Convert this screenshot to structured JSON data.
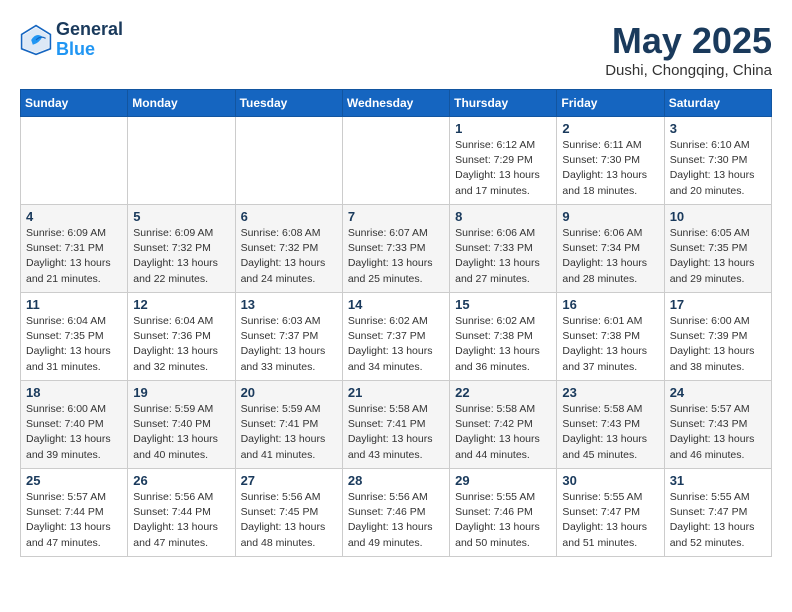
{
  "header": {
    "logo_line1": "General",
    "logo_line2": "Blue",
    "month": "May 2025",
    "location": "Dushi, Chongqing, China"
  },
  "days_of_week": [
    "Sunday",
    "Monday",
    "Tuesday",
    "Wednesday",
    "Thursday",
    "Friday",
    "Saturday"
  ],
  "weeks": [
    [
      {
        "day": "",
        "info": ""
      },
      {
        "day": "",
        "info": ""
      },
      {
        "day": "",
        "info": ""
      },
      {
        "day": "",
        "info": ""
      },
      {
        "day": "1",
        "info": "Sunrise: 6:12 AM\nSunset: 7:29 PM\nDaylight: 13 hours\nand 17 minutes."
      },
      {
        "day": "2",
        "info": "Sunrise: 6:11 AM\nSunset: 7:30 PM\nDaylight: 13 hours\nand 18 minutes."
      },
      {
        "day": "3",
        "info": "Sunrise: 6:10 AM\nSunset: 7:30 PM\nDaylight: 13 hours\nand 20 minutes."
      }
    ],
    [
      {
        "day": "4",
        "info": "Sunrise: 6:09 AM\nSunset: 7:31 PM\nDaylight: 13 hours\nand 21 minutes."
      },
      {
        "day": "5",
        "info": "Sunrise: 6:09 AM\nSunset: 7:32 PM\nDaylight: 13 hours\nand 22 minutes."
      },
      {
        "day": "6",
        "info": "Sunrise: 6:08 AM\nSunset: 7:32 PM\nDaylight: 13 hours\nand 24 minutes."
      },
      {
        "day": "7",
        "info": "Sunrise: 6:07 AM\nSunset: 7:33 PM\nDaylight: 13 hours\nand 25 minutes."
      },
      {
        "day": "8",
        "info": "Sunrise: 6:06 AM\nSunset: 7:33 PM\nDaylight: 13 hours\nand 27 minutes."
      },
      {
        "day": "9",
        "info": "Sunrise: 6:06 AM\nSunset: 7:34 PM\nDaylight: 13 hours\nand 28 minutes."
      },
      {
        "day": "10",
        "info": "Sunrise: 6:05 AM\nSunset: 7:35 PM\nDaylight: 13 hours\nand 29 minutes."
      }
    ],
    [
      {
        "day": "11",
        "info": "Sunrise: 6:04 AM\nSunset: 7:35 PM\nDaylight: 13 hours\nand 31 minutes."
      },
      {
        "day": "12",
        "info": "Sunrise: 6:04 AM\nSunset: 7:36 PM\nDaylight: 13 hours\nand 32 minutes."
      },
      {
        "day": "13",
        "info": "Sunrise: 6:03 AM\nSunset: 7:37 PM\nDaylight: 13 hours\nand 33 minutes."
      },
      {
        "day": "14",
        "info": "Sunrise: 6:02 AM\nSunset: 7:37 PM\nDaylight: 13 hours\nand 34 minutes."
      },
      {
        "day": "15",
        "info": "Sunrise: 6:02 AM\nSunset: 7:38 PM\nDaylight: 13 hours\nand 36 minutes."
      },
      {
        "day": "16",
        "info": "Sunrise: 6:01 AM\nSunset: 7:38 PM\nDaylight: 13 hours\nand 37 minutes."
      },
      {
        "day": "17",
        "info": "Sunrise: 6:00 AM\nSunset: 7:39 PM\nDaylight: 13 hours\nand 38 minutes."
      }
    ],
    [
      {
        "day": "18",
        "info": "Sunrise: 6:00 AM\nSunset: 7:40 PM\nDaylight: 13 hours\nand 39 minutes."
      },
      {
        "day": "19",
        "info": "Sunrise: 5:59 AM\nSunset: 7:40 PM\nDaylight: 13 hours\nand 40 minutes."
      },
      {
        "day": "20",
        "info": "Sunrise: 5:59 AM\nSunset: 7:41 PM\nDaylight: 13 hours\nand 41 minutes."
      },
      {
        "day": "21",
        "info": "Sunrise: 5:58 AM\nSunset: 7:41 PM\nDaylight: 13 hours\nand 43 minutes."
      },
      {
        "day": "22",
        "info": "Sunrise: 5:58 AM\nSunset: 7:42 PM\nDaylight: 13 hours\nand 44 minutes."
      },
      {
        "day": "23",
        "info": "Sunrise: 5:58 AM\nSunset: 7:43 PM\nDaylight: 13 hours\nand 45 minutes."
      },
      {
        "day": "24",
        "info": "Sunrise: 5:57 AM\nSunset: 7:43 PM\nDaylight: 13 hours\nand 46 minutes."
      }
    ],
    [
      {
        "day": "25",
        "info": "Sunrise: 5:57 AM\nSunset: 7:44 PM\nDaylight: 13 hours\nand 47 minutes."
      },
      {
        "day": "26",
        "info": "Sunrise: 5:56 AM\nSunset: 7:44 PM\nDaylight: 13 hours\nand 47 minutes."
      },
      {
        "day": "27",
        "info": "Sunrise: 5:56 AM\nSunset: 7:45 PM\nDaylight: 13 hours\nand 48 minutes."
      },
      {
        "day": "28",
        "info": "Sunrise: 5:56 AM\nSunset: 7:46 PM\nDaylight: 13 hours\nand 49 minutes."
      },
      {
        "day": "29",
        "info": "Sunrise: 5:55 AM\nSunset: 7:46 PM\nDaylight: 13 hours\nand 50 minutes."
      },
      {
        "day": "30",
        "info": "Sunrise: 5:55 AM\nSunset: 7:47 PM\nDaylight: 13 hours\nand 51 minutes."
      },
      {
        "day": "31",
        "info": "Sunrise: 5:55 AM\nSunset: 7:47 PM\nDaylight: 13 hours\nand 52 minutes."
      }
    ]
  ]
}
